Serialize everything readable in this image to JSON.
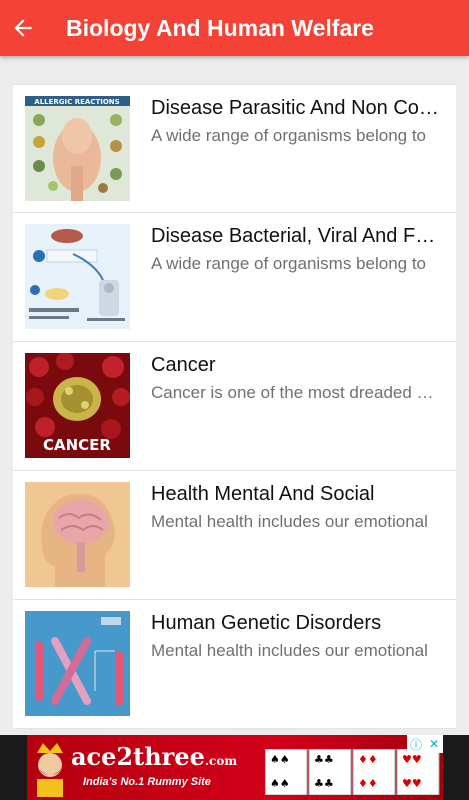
{
  "appbar": {
    "title": "Biology And Human Welfare",
    "color": "#f44336"
  },
  "items": [
    {
      "title": "Disease Parasitic And Non Communicable",
      "subtitle": "A wide range of organisms belong to",
      "thumb_text": "ALLERGIC REACTIONS"
    },
    {
      "title": "Disease Bacterial, Viral And Fungal",
      "subtitle": "A wide range of organisms belong to",
      "thumb_text": ""
    },
    {
      "title": "Cancer",
      "subtitle": "Cancer is one of the most dreaded diseases",
      "thumb_text": "CANCER"
    },
    {
      "title": "Health Mental And Social",
      "subtitle": "Mental health includes our emotional",
      "thumb_text": ""
    },
    {
      "title": "Human Genetic Disorders",
      "subtitle": "Mental health includes our emotional",
      "thumb_text": ""
    }
  ],
  "ad": {
    "brand": "ace2three",
    "brand_suffix": ".com",
    "tagline": "India's No.1 Rummy Site",
    "info_icon": "info-icon",
    "close_icon": "close-icon"
  }
}
